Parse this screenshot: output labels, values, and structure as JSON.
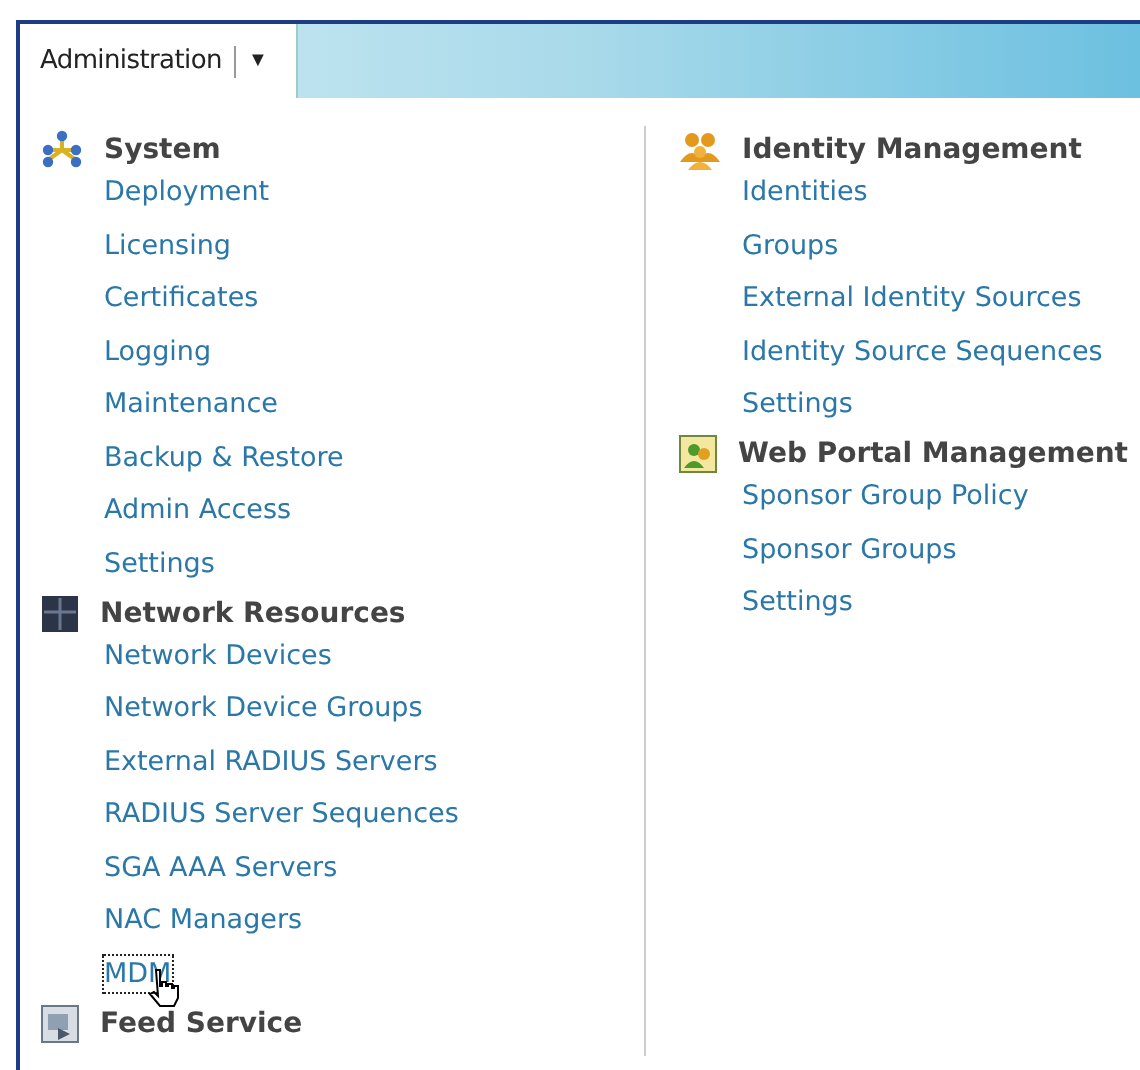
{
  "header": {
    "tab": {
      "label": "Administration",
      "dropdown": "▼"
    }
  },
  "columns": [
    {
      "sections": [
        {
          "title": "System",
          "kind": "nodes",
          "items": [
            {
              "label": "Deployment",
              "focused": false
            },
            {
              "label": "Licensing",
              "focused": false
            },
            {
              "label": "Certificates",
              "focused": false
            },
            {
              "label": "Logging",
              "focused": false
            },
            {
              "label": "Maintenance",
              "focused": false
            },
            {
              "label": "Backup & Restore",
              "focused": false
            },
            {
              "label": "Admin Access",
              "focused": false
            },
            {
              "label": "Settings",
              "focused": false
            }
          ]
        },
        {
          "title": "Network Resources",
          "kind": "rack",
          "items": [
            {
              "label": "Network Devices",
              "focused": false
            },
            {
              "label": "Network Device Groups",
              "focused": false
            },
            {
              "label": "External RADIUS Servers",
              "focused": false
            },
            {
              "label": "RADIUS Server Sequences",
              "focused": false
            },
            {
              "label": "SGA AAA Servers",
              "focused": false
            },
            {
              "label": "NAC Managers",
              "focused": false
            },
            {
              "label": "MDM",
              "focused": true
            }
          ]
        },
        {
          "title": "Feed Service",
          "kind": "feed"
        }
      ]
    },
    {
      "sections": [
        {
          "title": "Identity Management",
          "kind": "people",
          "items": [
            {
              "label": "Identities",
              "focused": false
            },
            {
              "label": "Groups",
              "focused": false
            },
            {
              "label": "External Identity Sources",
              "focused": false
            },
            {
              "label": "Identity Source Sequences",
              "focused": false
            },
            {
              "label": "Settings",
              "focused": false
            }
          ]
        },
        {
          "title": "Web Portal Management",
          "kind": "portal",
          "items": [
            {
              "label": "Sponsor Group Policy",
              "focused": false
            },
            {
              "label": "Sponsor Groups",
              "focused": false
            },
            {
              "label": "Settings",
              "focused": false
            }
          ]
        }
      ]
    }
  ]
}
